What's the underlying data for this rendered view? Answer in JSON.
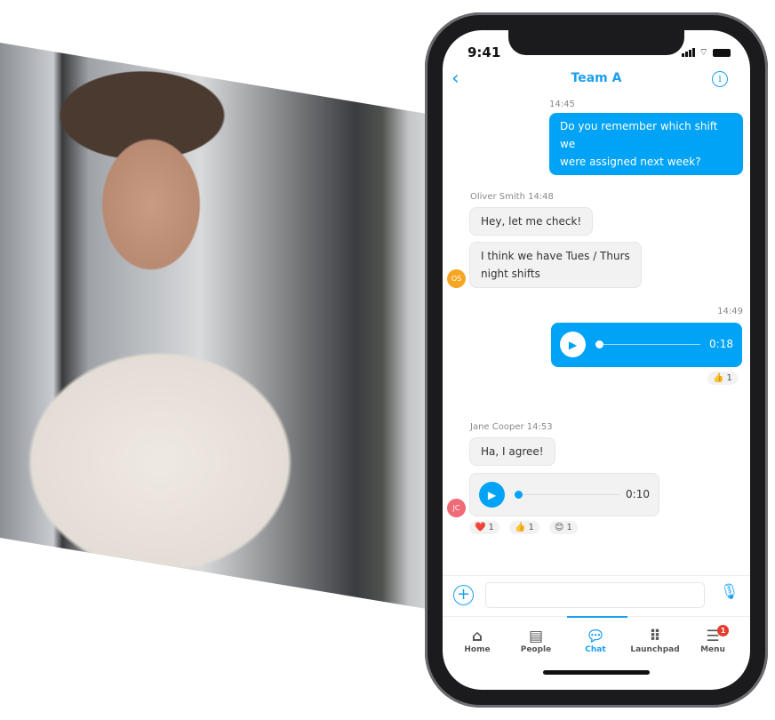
{
  "status_bar": {
    "time": "9:41"
  },
  "header": {
    "title": "Team A",
    "back_icon": "chevron-left-icon",
    "info_icon": "info-icon"
  },
  "accent": "#00a3f5",
  "messages": [
    {
      "time": "14:45",
      "text_lines": [
        "Do you remember which shift we",
        "were assigned next week?"
      ]
    },
    {
      "sender": "Oliver Smith 14:48",
      "initials": "OS",
      "texts": [
        "Hey, let me check!",
        "I think we have Tues / Thurs night shifts"
      ]
    },
    {
      "time": "14:49",
      "voice_duration": "0:18",
      "reactions": [
        {
          "emoji": "👍",
          "count": "1"
        }
      ]
    },
    {
      "sender": "Jane Cooper 14:53",
      "initials": "JC",
      "text": "Ha, I agree!",
      "voice_duration": "0:10",
      "reactions": [
        {
          "emoji": "❤️",
          "count": "1"
        },
        {
          "emoji": "👍",
          "count": "1"
        },
        {
          "emoji": "😊",
          "count": "1"
        }
      ]
    }
  ],
  "composer": {
    "value": "",
    "add_icon": "plus-circle-icon",
    "mic_icon": "microphone-icon"
  },
  "nav": [
    {
      "label": "Home",
      "icon": "home-icon"
    },
    {
      "label": "People",
      "icon": "contacts-icon"
    },
    {
      "label": "Chat",
      "icon": "chat-icon",
      "active": true
    },
    {
      "label": "Launchpad",
      "icon": "grid-icon"
    },
    {
      "label": "Menu",
      "icon": "menu-icon",
      "badge": "1"
    }
  ]
}
